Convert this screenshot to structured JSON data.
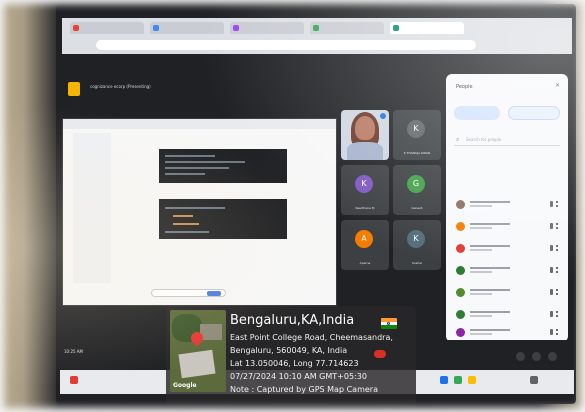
{
  "meet": {
    "title": "cognizance ecorp (Presenting)",
    "time": "10:25 AM",
    "people_title": "People",
    "search_placeholder": "Search for people"
  },
  "tiles": [
    {
      "initial": "",
      "name": "You",
      "color": "#cfd6e0"
    },
    {
      "initial": "K",
      "name": "K THANUJA KIRAN",
      "color": "#5f6368"
    },
    {
      "initial": "K",
      "name": "Keerthana M",
      "color": "#7e57c2"
    },
    {
      "initial": "G",
      "name": "Ganesh",
      "color": "#43a047"
    },
    {
      "initial": "A",
      "name": "Aparna",
      "color": "#f57c00"
    },
    {
      "initial": "K",
      "name": "Kushal",
      "color": "#546e7a"
    }
  ],
  "people": [
    {
      "color": "#8d6e63"
    },
    {
      "color": "#f57c00"
    },
    {
      "color": "#e53935"
    },
    {
      "color": "#2e7d32"
    },
    {
      "color": "#558b2f"
    },
    {
      "color": "#2e7d32"
    },
    {
      "color": "#8e24aa"
    }
  ],
  "geotag": {
    "city": "Bengaluru,KA,India",
    "address_1": "East Point College Road, Cheemasandra,",
    "address_2": "Bengaluru, 560049, KA, India",
    "coords": "Lat 13.050046, Long 77.714623",
    "datetime": "07/27/2024 10:10 AM GMT+05:30",
    "note": "Note : Captured by GPS Map Camera",
    "map_label": "Google"
  }
}
